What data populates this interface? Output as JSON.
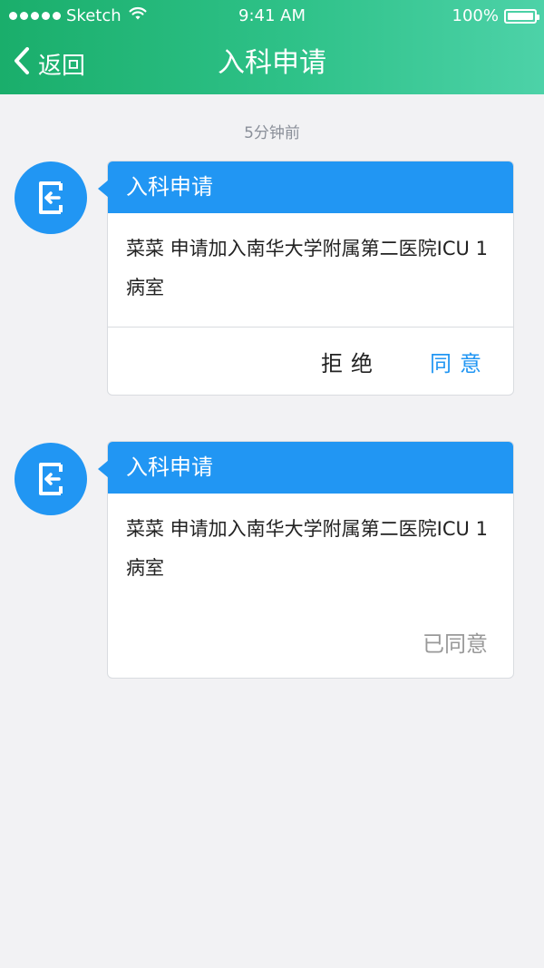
{
  "status_bar": {
    "carrier": "Sketch",
    "time": "9:41 AM",
    "battery": "100%",
    "signal_icon": "signal-dots-icon",
    "wifi_icon": "wifi-icon",
    "battery_icon": "battery-icon",
    "battery_level": 1.0
  },
  "nav": {
    "back_label": "返回",
    "back_icon": "chevron-left-icon",
    "title": "入科申请"
  },
  "colors": {
    "header_gradient_start": "#1aae6b",
    "header_gradient_end": "#4dd2a8",
    "accent_blue": "#2196f3",
    "background": "#f2f2f4"
  },
  "timestamp": "5分钟前",
  "requests": [
    {
      "avatar_icon": "exit-door-icon",
      "title": "入科申请",
      "message": "菜菜  申请加入南华大学附属第二医院ICU 1病室",
      "reject_label": "拒绝",
      "agree_label": "同意"
    },
    {
      "avatar_icon": "exit-door-icon",
      "title": "入科申请",
      "message": "菜菜  申请加入南华大学附属第二医院ICU 1病室",
      "status": "已同意"
    }
  ]
}
